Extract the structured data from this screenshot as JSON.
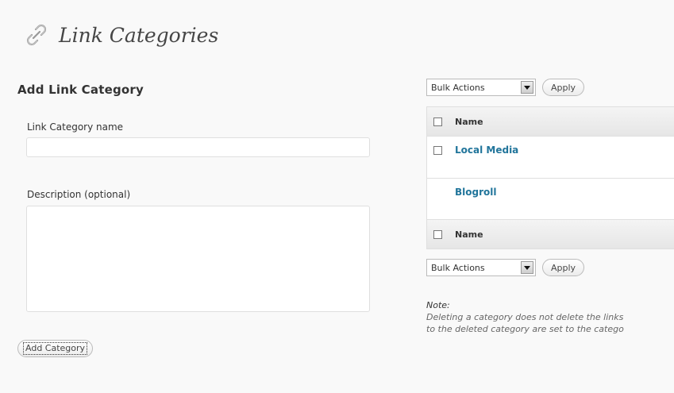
{
  "header": {
    "title": "Link Categories",
    "icon": "link-icon"
  },
  "add_form": {
    "title": "Add Link Category",
    "name_label": "Link Category name",
    "name_value": "",
    "description_label": "Description (optional)",
    "description_value": "",
    "submit_label": "Add Category"
  },
  "bulk_top": {
    "selected": "Bulk Actions",
    "apply_label": "Apply"
  },
  "bulk_bottom": {
    "selected": "Bulk Actions",
    "apply_label": "Apply"
  },
  "table": {
    "header_label": "Name",
    "footer_label": "Name",
    "rows": [
      {
        "name": "Local Media",
        "has_checkbox": true
      },
      {
        "name": "Blogroll",
        "has_checkbox": false
      }
    ]
  },
  "note": {
    "title": "Note:",
    "line1": "Deleting a category does not delete the links",
    "line2": "to the deleted category are set to the catego"
  },
  "colors": {
    "link": "#21759b",
    "background": "#f9f9f9"
  }
}
